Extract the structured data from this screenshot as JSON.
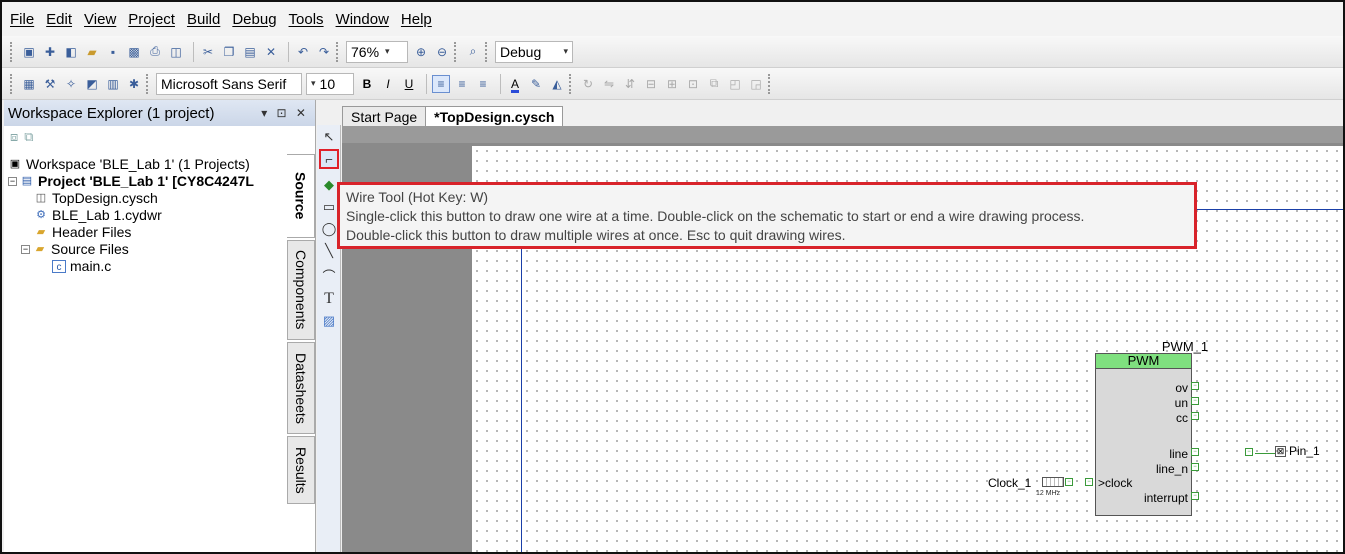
{
  "menu": [
    "File",
    "Edit",
    "View",
    "Project",
    "Build",
    "Debug",
    "Tools",
    "Window",
    "Help"
  ],
  "toolbar": {
    "zoom": "76%",
    "config": "Debug",
    "font_name": "Microsoft Sans Serif",
    "font_size": "10"
  },
  "explorer": {
    "title": "Workspace Explorer (1 project)",
    "controls": "▾ ⊡ ✕",
    "tree": {
      "workspace": "Workspace 'BLE_Lab 1' (1 Projects)",
      "project": "Project 'BLE_Lab 1' [CY8C4247L",
      "topdesign": "TopDesign.cysch",
      "cydwr": "BLE_Lab 1.cydwr",
      "header_files": "Header Files",
      "source_files": "Source Files",
      "main": "main.c"
    },
    "side_tabs": [
      "Source",
      "Components",
      "Datasheets",
      "Results"
    ]
  },
  "doc_tabs": [
    "Start Page",
    "*TopDesign.cysch"
  ],
  "tooltip": {
    "title": "Wire Tool (Hot Key: W)",
    "line1": "Single-click this button to draw one wire at a time. Double-click on the schematic to start or end a wire drawing process.",
    "line2": "Double-click this button to draw multiple wires at once. Esc to quit drawing wires."
  },
  "schematic": {
    "pwm_instance": "PWM_1",
    "pwm_type": "PWM",
    "pwm_pins": {
      "ov": "ov",
      "un": "un",
      "cc": "cc",
      "line": "line",
      "line_n": "line_n",
      "clock": "clock",
      "interrupt": "interrupt"
    },
    "clock_label": "Clock_1",
    "clock_freq": "12 MHz",
    "pin_label": "Pin_1"
  },
  "colors": {
    "pwm_header": "#7fe07f",
    "wire": "#1a3fa8",
    "highlight": "#d8232a"
  }
}
